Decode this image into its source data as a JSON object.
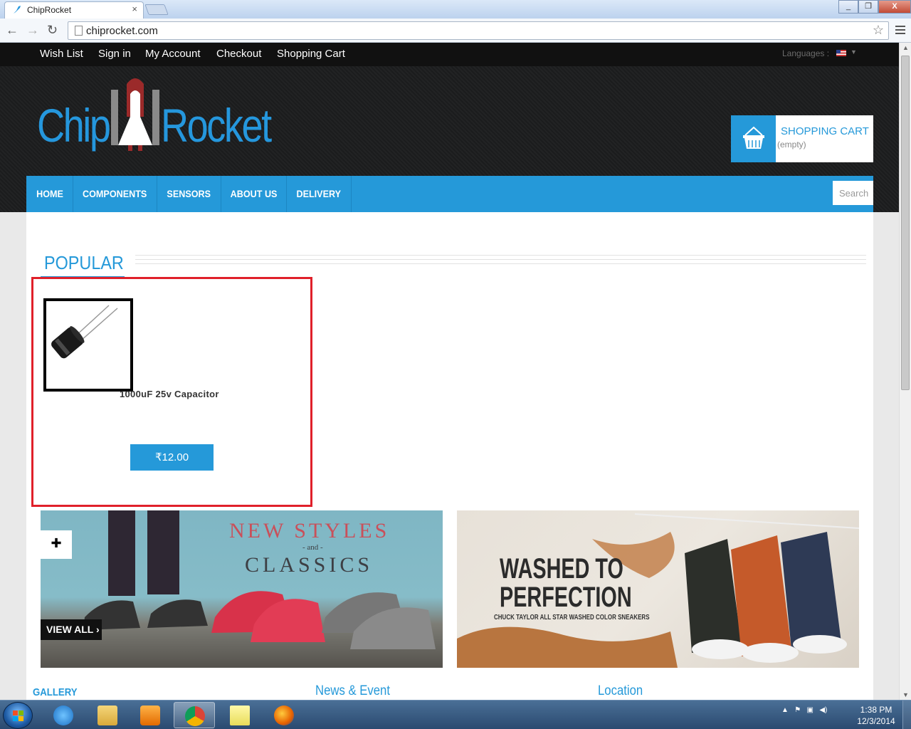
{
  "browser": {
    "tab_title": "ChipRocket",
    "tab_close": "×",
    "url": "chiprocket.com",
    "minimize": "_",
    "maximize": "❐",
    "close": "X"
  },
  "topbar": {
    "links": [
      "Wish List",
      "Sign in",
      "My Account",
      "Checkout",
      "Shopping Cart"
    ],
    "languages_label": "Languages :"
  },
  "logo": {
    "left": "Chip",
    "right": "Rocket"
  },
  "cart": {
    "title": "SHOPPING CART",
    "status": "(empty)"
  },
  "nav": {
    "items": [
      "HOME",
      "COMPONENTS",
      "SENSORS",
      "ABOUT US",
      "DELIVERY"
    ],
    "search_placeholder": "Search"
  },
  "popular": {
    "heading": "POPULAR",
    "product": {
      "name": "1000uF 25v Capacitor",
      "price": "₹12.00"
    }
  },
  "banners": {
    "left": {
      "line1": "NEW STYLES",
      "line2": "- and -",
      "line3": "CLASSICS",
      "cta": "VIEW ALL ›"
    },
    "right": {
      "line1": "WASHED TO",
      "line2": "PERFECTION",
      "sub": "CHUCK TAYLOR ALL STAR WASHED COLOR SNEAKERS"
    }
  },
  "footer": {
    "gallery": "GALLERY",
    "news": "News & Event",
    "location": "Location"
  },
  "taskbar": {
    "time": "1:38 PM",
    "date": "12/3/2014"
  },
  "colors": {
    "accent": "#2599d9",
    "highlight": "#e0202a",
    "header_bg": "#1e1f20"
  }
}
